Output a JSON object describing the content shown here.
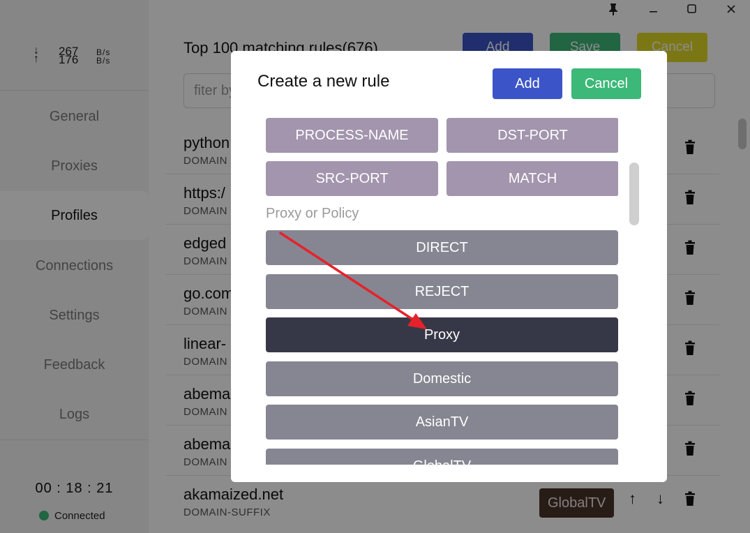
{
  "sidebar": {
    "upload": {
      "arrow": "↑",
      "value": "176",
      "unit": "B/s"
    },
    "download": {
      "arrow": "↓",
      "value": "267",
      "unit": "B/s"
    },
    "items": [
      {
        "label": "General"
      },
      {
        "label": "Proxies"
      },
      {
        "label": "Profiles"
      },
      {
        "label": "Connections"
      },
      {
        "label": "Settings"
      },
      {
        "label": "Feedback"
      },
      {
        "label": "Logs"
      }
    ],
    "active_index": 2,
    "timer": "00 : 18 : 21",
    "status": "Connected",
    "status_color": "#3cb878"
  },
  "window": {
    "pin_icon": "pin-icon",
    "minimize_icon": "minimize-icon",
    "maximize_icon": "maximize-icon",
    "close_icon": "close-icon"
  },
  "main": {
    "title": "Top 100 matching rules(676)",
    "add_label": "Add",
    "save_label": "Save",
    "cancel_label": "Cancel",
    "filter_placeholder": "fiter by",
    "rules": [
      {
        "name": "python",
        "type": "DOMAIN"
      },
      {
        "name": "https:/",
        "type": "DOMAIN"
      },
      {
        "name": "edged",
        "type": "DOMAIN"
      },
      {
        "name": "go.com",
        "type": "DOMAIN"
      },
      {
        "name": "linear-",
        "type": "DOMAIN"
      },
      {
        "name": "abema",
        "type": "DOMAIN"
      },
      {
        "name": "abema",
        "type": "DOMAIN"
      },
      {
        "name": "akamaized.net",
        "type": "DOMAIN-SUFFIX",
        "policy": "GlobalTV",
        "up": "↑",
        "down": "↓"
      }
    ]
  },
  "modal": {
    "title": "Create a new rule",
    "add_label": "Add",
    "cancel_label": "Cancel",
    "rule_types": [
      "PROCESS-NAME",
      "DST-PORT",
      "SRC-PORT",
      "MATCH"
    ],
    "section_label": "Proxy or Policy",
    "policies": [
      "DIRECT",
      "REJECT",
      "Proxy",
      "Domestic",
      "AsianTV",
      "GlobalTV"
    ],
    "selected_policy": "Proxy"
  },
  "colors": {
    "add": "#3b55c9",
    "save": "#3cb878",
    "cancel_main": "#e0d925",
    "rule_type": "#a295ad",
    "policy": "#868692",
    "policy_selected": "#373847",
    "annotation_arrow": "#e5222b"
  }
}
